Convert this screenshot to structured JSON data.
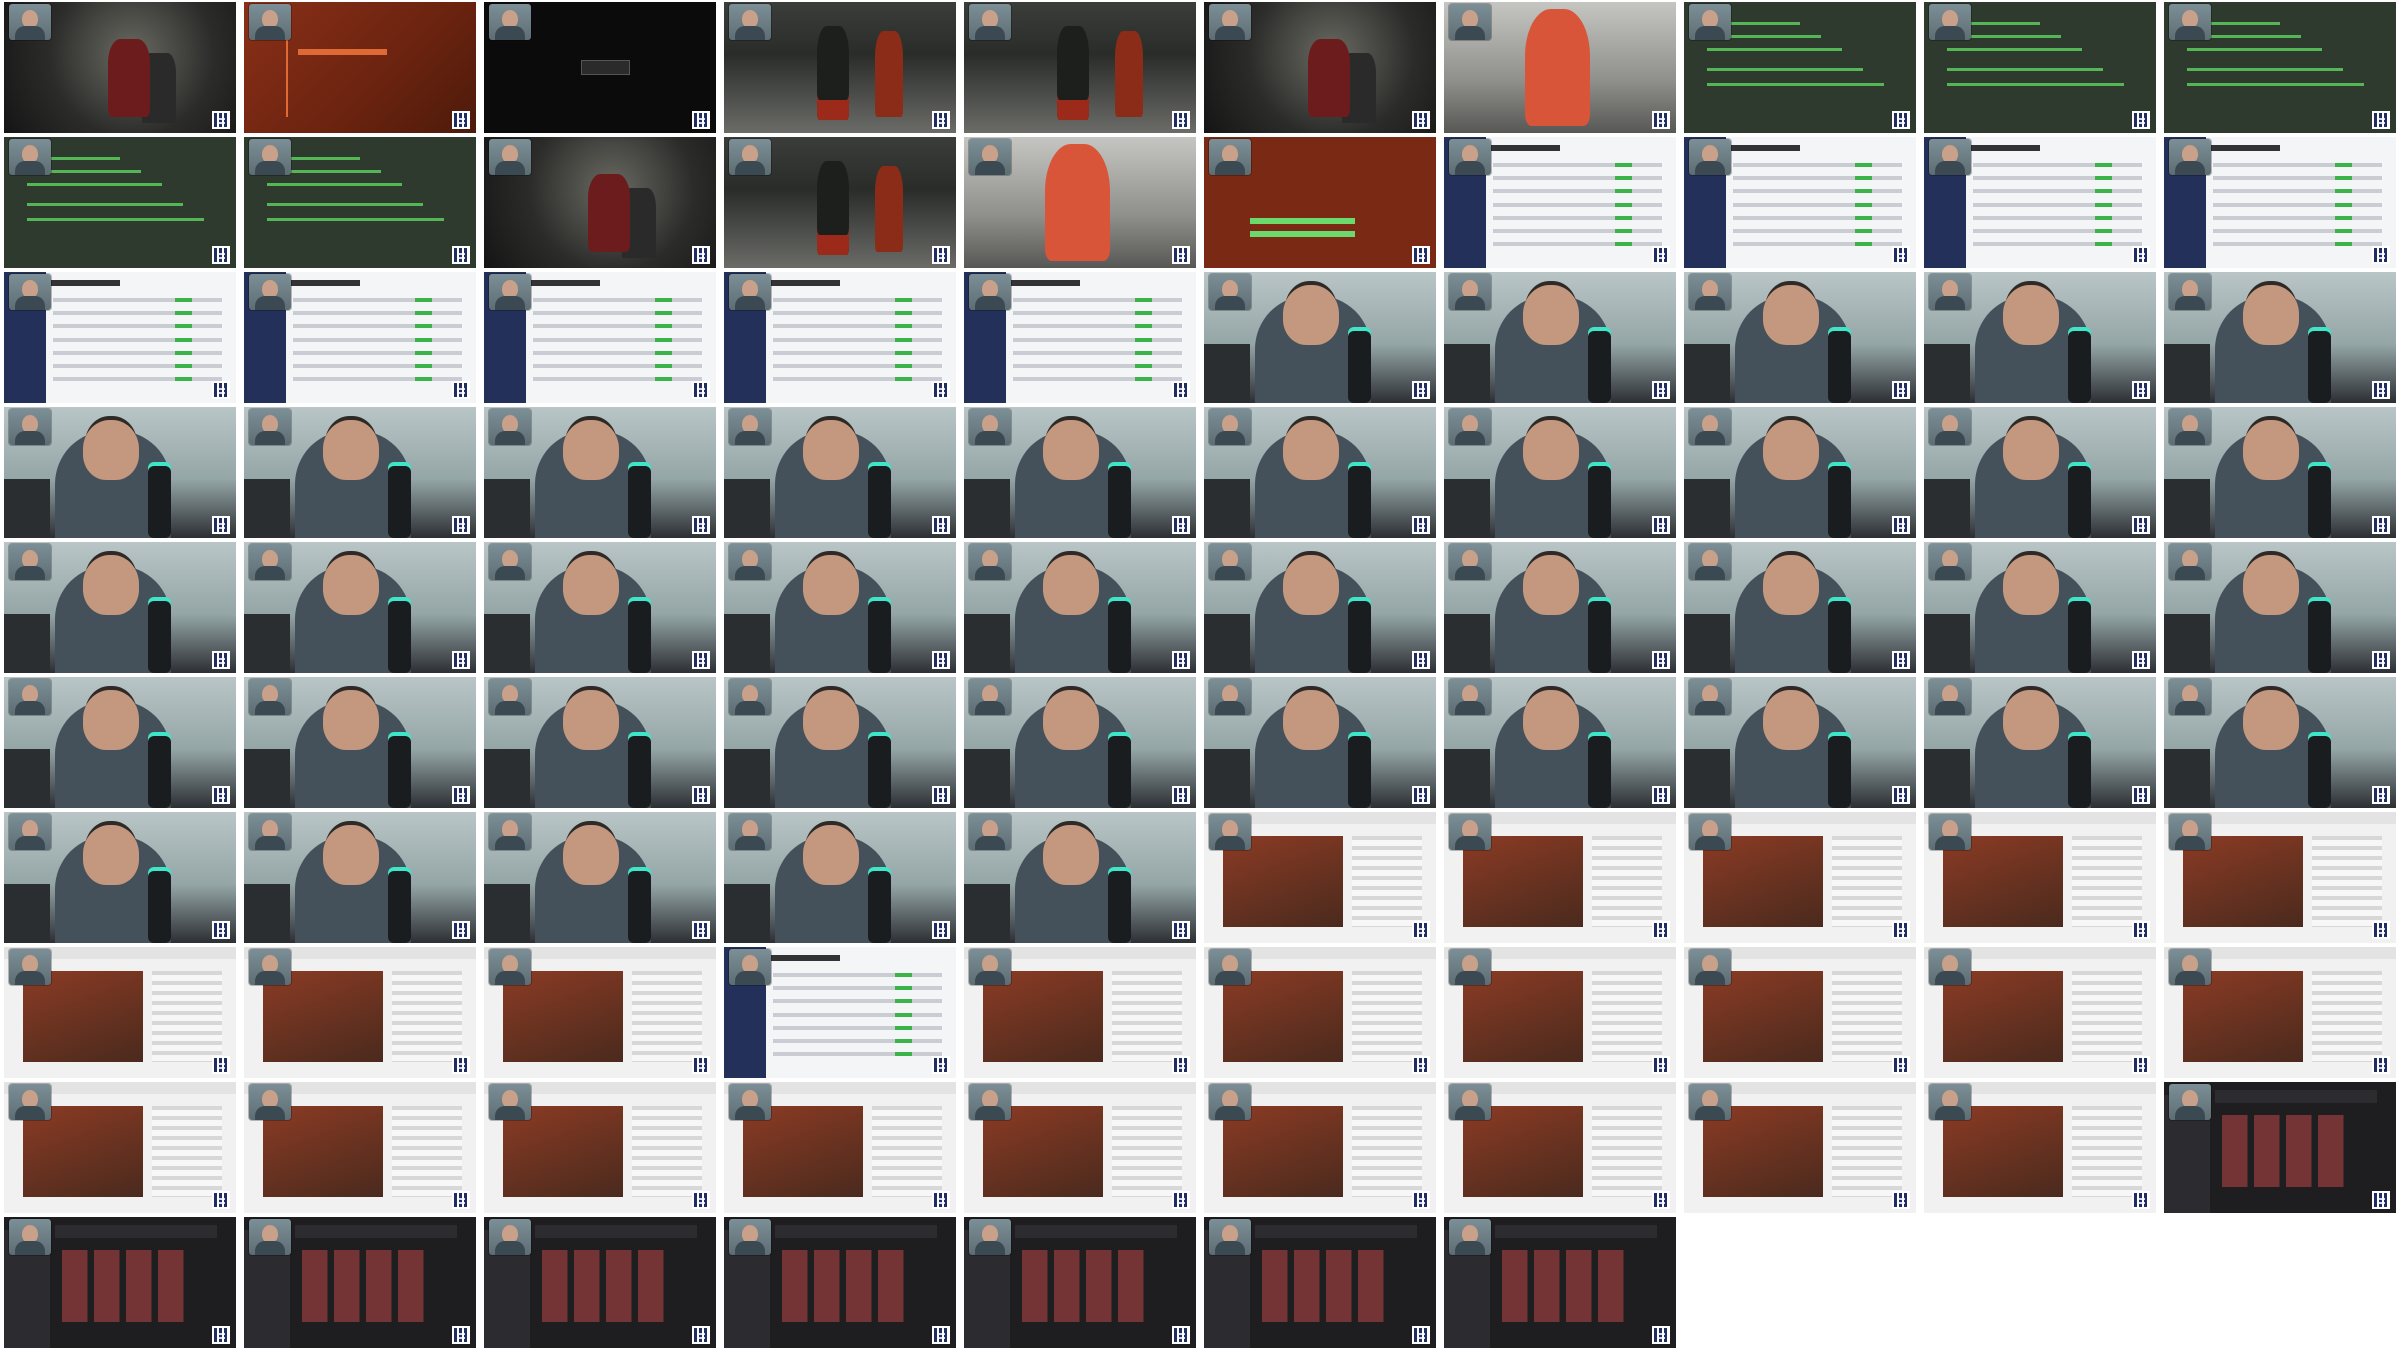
{
  "layout": {
    "cols": 10,
    "rows": 10,
    "total_tiles": 97
  },
  "tiles": [
    {
      "scene": "game-dark"
    },
    {
      "scene": "game-orange"
    },
    {
      "scene": "game-black"
    },
    {
      "scene": "game-room"
    },
    {
      "scene": "game-room"
    },
    {
      "scene": "game-dark"
    },
    {
      "scene": "game-red"
    },
    {
      "scene": "terminal"
    },
    {
      "scene": "terminal"
    },
    {
      "scene": "terminal"
    },
    {
      "scene": "terminal"
    },
    {
      "scene": "terminal"
    },
    {
      "scene": "game-dark"
    },
    {
      "scene": "game-room"
    },
    {
      "scene": "game-red"
    },
    {
      "scene": "terminal-orange"
    },
    {
      "scene": "messages"
    },
    {
      "scene": "messages"
    },
    {
      "scene": "messages"
    },
    {
      "scene": "messages"
    },
    {
      "scene": "messages"
    },
    {
      "scene": "messages"
    },
    {
      "scene": "messages"
    },
    {
      "scene": "messages"
    },
    {
      "scene": "messages"
    },
    {
      "scene": "webcam"
    },
    {
      "scene": "webcam"
    },
    {
      "scene": "webcam"
    },
    {
      "scene": "webcam"
    },
    {
      "scene": "webcam"
    },
    {
      "scene": "webcam"
    },
    {
      "scene": "webcam"
    },
    {
      "scene": "webcam"
    },
    {
      "scene": "webcam"
    },
    {
      "scene": "webcam"
    },
    {
      "scene": "webcam"
    },
    {
      "scene": "webcam"
    },
    {
      "scene": "webcam"
    },
    {
      "scene": "webcam"
    },
    {
      "scene": "webcam"
    },
    {
      "scene": "webcam"
    },
    {
      "scene": "webcam"
    },
    {
      "scene": "webcam"
    },
    {
      "scene": "webcam"
    },
    {
      "scene": "webcam"
    },
    {
      "scene": "webcam"
    },
    {
      "scene": "webcam"
    },
    {
      "scene": "webcam"
    },
    {
      "scene": "webcam"
    },
    {
      "scene": "webcam"
    },
    {
      "scene": "webcam"
    },
    {
      "scene": "webcam"
    },
    {
      "scene": "webcam"
    },
    {
      "scene": "webcam"
    },
    {
      "scene": "webcam"
    },
    {
      "scene": "webcam"
    },
    {
      "scene": "webcam"
    },
    {
      "scene": "webcam"
    },
    {
      "scene": "webcam"
    },
    {
      "scene": "webcam"
    },
    {
      "scene": "webcam"
    },
    {
      "scene": "webcam"
    },
    {
      "scene": "webcam"
    },
    {
      "scene": "webcam"
    },
    {
      "scene": "webcam"
    },
    {
      "scene": "browser"
    },
    {
      "scene": "browser"
    },
    {
      "scene": "browser"
    },
    {
      "scene": "browser"
    },
    {
      "scene": "browser"
    },
    {
      "scene": "browser"
    },
    {
      "scene": "browser"
    },
    {
      "scene": "browser"
    },
    {
      "scene": "messages"
    },
    {
      "scene": "browser"
    },
    {
      "scene": "browser"
    },
    {
      "scene": "browser"
    },
    {
      "scene": "browser"
    },
    {
      "scene": "browser"
    },
    {
      "scene": "browser"
    },
    {
      "scene": "browser"
    },
    {
      "scene": "browser"
    },
    {
      "scene": "browser"
    },
    {
      "scene": "browser"
    },
    {
      "scene": "browser"
    },
    {
      "scene": "browser"
    },
    {
      "scene": "browser"
    },
    {
      "scene": "browser"
    },
    {
      "scene": "browser"
    },
    {
      "scene": "dark"
    },
    {
      "scene": "dark"
    },
    {
      "scene": "dark"
    },
    {
      "scene": "dark"
    },
    {
      "scene": "dark"
    },
    {
      "scene": "dark"
    },
    {
      "scene": "dark"
    },
    {
      "scene": "dark"
    }
  ]
}
